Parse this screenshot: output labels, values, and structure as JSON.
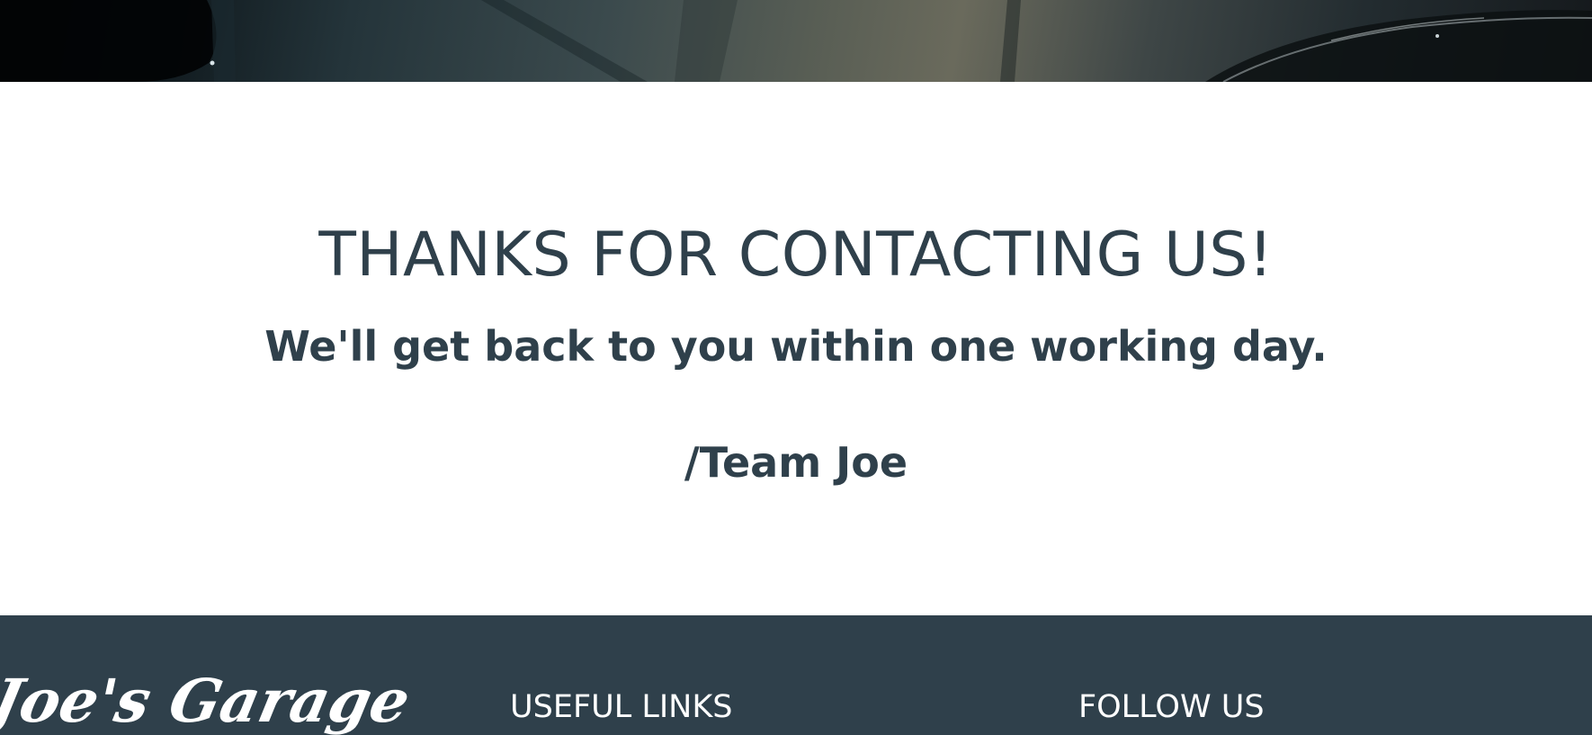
{
  "hero": {
    "image_alt": "garage photo banner"
  },
  "thanks": {
    "title": "THANKS FOR CONTACTING US!",
    "subtitle": "We'll get back to you within one working day.",
    "signature": "/Team Joe"
  },
  "footer": {
    "logo_text": "Joe's Garage",
    "useful_links_heading": "USEFUL LINKS",
    "follow_us_heading": "FOLLOW US"
  },
  "colors": {
    "text_primary": "#2f404b",
    "footer_background": "#2f404b",
    "footer_text": "#ffffff",
    "page_background": "#ffffff"
  }
}
